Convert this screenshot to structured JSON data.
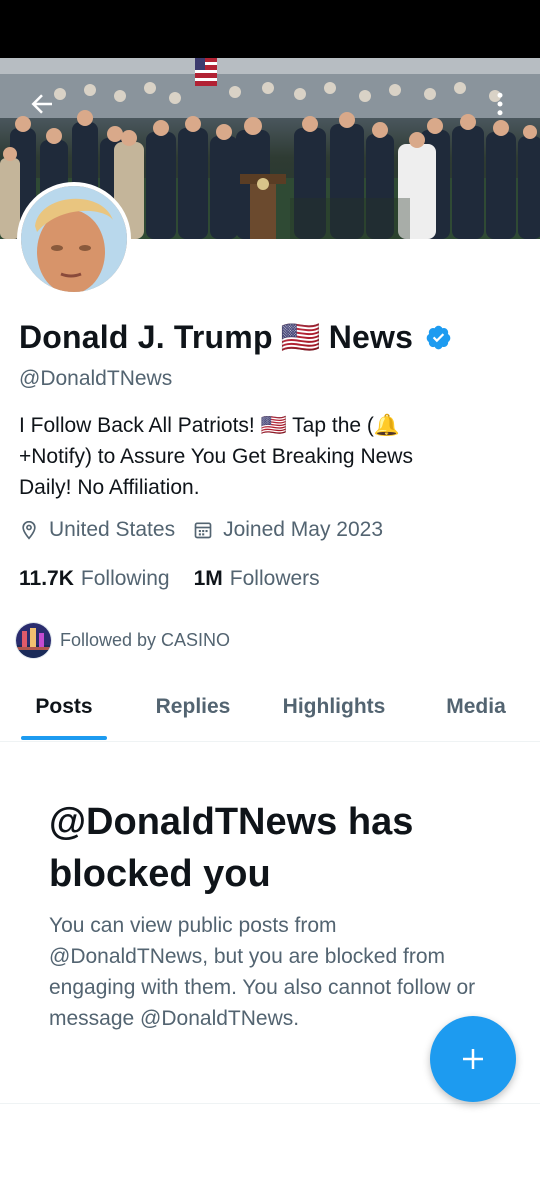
{
  "profile": {
    "display_name": "Donald J. Trump",
    "name_emoji": "🇺🇸",
    "name_suffix": "News",
    "handle": "@DonaldTNews",
    "bio_line1": "I Follow Back All Patriots! 🇺🇸 Tap the (🔔",
    "bio_line2": "+Notify) to Assure You Get Breaking News",
    "bio_line3": "Daily! No Affiliation.",
    "location": "United States",
    "joined": "Joined May 2023",
    "following_count": "11.7K",
    "following_label": "Following",
    "followers_count": "1M",
    "followers_label": "Followers",
    "followed_by": "Followed by CASINO"
  },
  "tabs": [
    {
      "label": "Posts",
      "active": true
    },
    {
      "label": "Replies",
      "active": false
    },
    {
      "label": "Highlights",
      "active": false
    },
    {
      "label": "Media",
      "active": false
    }
  ],
  "blocked": {
    "title": "@DonaldTNews has blocked you",
    "message": "You can view public posts from @DonaldTNews, but you are blocked from engaging with them. You also cannot follow or message @DonaldTNews."
  },
  "icons": {
    "back": "arrow-left-icon",
    "more": "more-vertical-icon",
    "verified": "verified-badge-icon",
    "location": "location-pin-icon",
    "calendar": "calendar-icon",
    "compose": "plus-icon"
  },
  "colors": {
    "accent": "#1d9bf0",
    "text_primary": "#0f1419",
    "text_secondary": "#536471"
  }
}
